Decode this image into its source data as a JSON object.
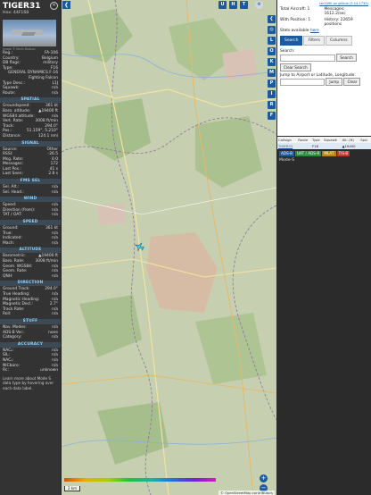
{
  "aircraft": {
    "callsign": "TIGER31",
    "hex": "Hex: 44F168",
    "photo_credit": "Image © Kevin Bodson"
  },
  "info_rows": [
    {
      "k": "Reg.:",
      "v": "FA-106"
    },
    {
      "k": "Country:",
      "v": "Belgium"
    },
    {
      "k": "DB flags:",
      "v": "military"
    },
    {
      "k": "Type:",
      "v": "F16"
    },
    {
      "k": "",
      "v": "GENERAL DYNAMICS F-16 Fighting Falcon"
    },
    {
      "k": "Type Desc.:",
      "v": "L1J"
    },
    {
      "k": "Squawk:",
      "v": "n/a"
    },
    {
      "k": "Route:",
      "v": "n/a"
    }
  ],
  "sections": [
    {
      "title": "SPATIAL",
      "rows": [
        {
          "k": "Groundspeed:",
          "v": "361 kt"
        },
        {
          "k": "Baro. altitude:",
          "v": "▲19400 ft"
        },
        {
          "k": "WGS84 altitude:",
          "v": "n/a"
        },
        {
          "k": "Vert. Rate:",
          "v": "3008 ft/min"
        },
        {
          "k": "Track:",
          "v": "294.0°"
        },
        {
          "k": "Pos.:",
          "v": "51.159°, 5.210°"
        },
        {
          "k": "Distance:",
          "v": "124.1 nmi"
        }
      ]
    },
    {
      "title": "SIGNAL",
      "rows": [
        {
          "k": "Source:",
          "v": "Other"
        },
        {
          "k": "RSSI:",
          "v": "-26.5"
        },
        {
          "k": "Msg. Rate:",
          "v": "0.0"
        },
        {
          "k": "Messages:",
          "v": "172"
        },
        {
          "k": "Last Pos.:",
          "v": "41 s"
        },
        {
          "k": "Last Seen:",
          "v": "2.8 s"
        }
      ]
    },
    {
      "title": "FMS SEL",
      "rows": [
        {
          "k": "Sel. Alt.:",
          "v": "n/a"
        },
        {
          "k": "Sel. Head.:",
          "v": "n/a"
        }
      ]
    },
    {
      "title": "WIND",
      "rows": [
        {
          "k": "Speed:",
          "v": "n/a"
        },
        {
          "k": "Direction (from):",
          "v": "n/a"
        },
        {
          "k": "TAT / OAT:",
          "v": "n/a"
        }
      ]
    },
    {
      "title": "SPEED",
      "rows": [
        {
          "k": "Ground:",
          "v": "361 kt"
        },
        {
          "k": "True:",
          "v": "n/a"
        },
        {
          "k": "Indicated:",
          "v": "n/a"
        },
        {
          "k": "Mach:",
          "v": "n/a"
        }
      ]
    },
    {
      "title": "ALTITUDE",
      "rows": [
        {
          "k": "Barometric:",
          "v": "▲19400 ft"
        },
        {
          "k": "Baro. Rate:",
          "v": "3008 ft/min"
        },
        {
          "k": "Geom. WGS84:",
          "v": "n/a"
        },
        {
          "k": "Geom. Rate:",
          "v": "n/a"
        },
        {
          "k": "QNH:",
          "v": "n/a"
        }
      ]
    },
    {
      "title": "DIRECTION",
      "rows": [
        {
          "k": "Ground Track:",
          "v": "294.0°"
        },
        {
          "k": "True Heading:",
          "v": "n/a"
        },
        {
          "k": "Magnetic Heading:",
          "v": "n/a"
        },
        {
          "k": "Magnetic Decl.:",
          "v": "2.7°"
        },
        {
          "k": "Track Rate:",
          "v": "n/a"
        },
        {
          "k": "Roll:",
          "v": "n/a"
        }
      ]
    },
    {
      "title": "STUFF",
      "rows": [
        {
          "k": "Nav. Modes:",
          "v": "n/a"
        },
        {
          "k": "ADS-B Ver.:",
          "v": "none"
        },
        {
          "k": "Category:",
          "v": "n/a"
        }
      ]
    },
    {
      "title": "ACCURACY",
      "rows": [
        {
          "k": "NACₚ:",
          "v": "n/a"
        },
        {
          "k": "SIL:",
          "v": "n/a"
        },
        {
          "k": "NACᵥ:",
          "v": "n/a"
        },
        {
          "k": "NICbaro:",
          "v": "n/a"
        },
        {
          "k": "Rc:",
          "v": "unknown"
        }
      ]
    }
  ],
  "footer_text": "Learn more about Mode S data type by hovering over each data label.",
  "map": {
    "top_buttons": [
      "U",
      "H",
      "T"
    ],
    "side_buttons": [
      "L",
      "O",
      "K",
      "M",
      "P",
      "I",
      "R",
      "F"
    ],
    "scale": "2 km",
    "attribution": "© OpenStreetMap contributors"
  },
  "right": {
    "version": "tar1090 on github (3.14.1733)",
    "total_aircraft_label": "Total Aircraft: 1",
    "messages_label": "Messages:",
    "messages_value": "1612.2/sec",
    "with_position_label": "With Position: 1",
    "history_label": "History: 22659 positions",
    "stats_label": "Stats available",
    "stats_link": "here",
    "tabs": [
      "Search",
      "Filters",
      "Columns"
    ],
    "search_label": "Search:",
    "search_button": "Search",
    "clear_button": "Clear Search",
    "jump_label": "Jump to Airport or Latitude, Longitude:",
    "jump_button": "Jump",
    "clear2_button": "Clear",
    "table_headers": [
      "Callsign",
      "Route",
      "Type",
      "Squawk",
      "Alt. (ft)",
      "Spd."
    ],
    "table_row": [
      "TIGER31",
      "",
      "F16",
      "",
      "▲19400",
      ""
    ],
    "badges": [
      {
        "label": "ADS-B",
        "color": "#1c5aa0"
      },
      {
        "label": "UAT / ADS-R",
        "color": "#2c8a3c"
      },
      {
        "label": "MLAT",
        "color": "#b8860b"
      },
      {
        "label": "TIS-B",
        "color": "#c0392b"
      }
    ],
    "mode_s_label": "Mode-S"
  }
}
